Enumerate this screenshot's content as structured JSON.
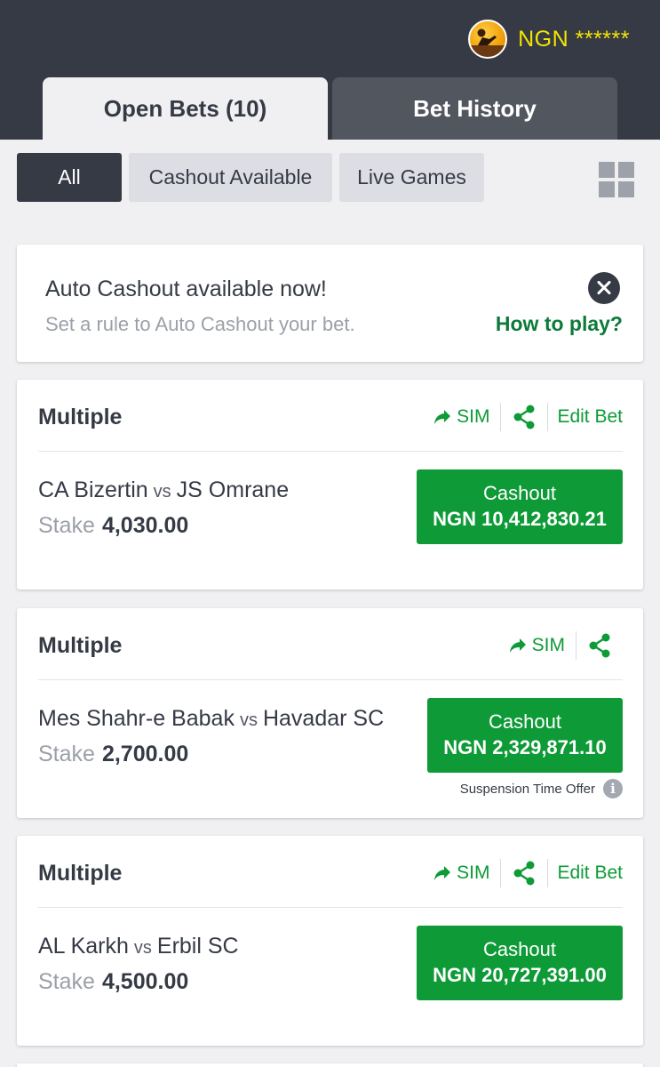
{
  "header": {
    "currency": "NGN",
    "balance_masked": "******",
    "balance_display": "NGN ******"
  },
  "tabs": [
    {
      "label": "Open Bets (10)",
      "active": true
    },
    {
      "label": "Bet History",
      "active": false
    }
  ],
  "filters": [
    {
      "label": "All",
      "selected": true
    },
    {
      "label": "Cashout Available",
      "selected": false
    },
    {
      "label": "Live Games",
      "selected": false
    }
  ],
  "promo": {
    "title": "Auto Cashout available now!",
    "subtitle": "Set a rule to Auto Cashout your bet.",
    "link": "How to play?"
  },
  "bets": [
    {
      "type": "Multiple",
      "sim_label": "SIM",
      "edit_label": "Edit Bet",
      "home": "CA Bizertin",
      "vs": "vs",
      "away": "JS Omrane",
      "stake_label": "Stake",
      "stake": "4,030.00",
      "cashout_label": "Cashout",
      "cashout_amount": "NGN 10,412,830.21"
    },
    {
      "type": "Multiple",
      "sim_label": "SIM",
      "home": "Mes Shahr-e Babak",
      "vs": "vs",
      "away": "Havadar SC",
      "stake_label": "Stake",
      "stake": "2,700.00",
      "cashout_label": "Cashout",
      "cashout_amount": "NGN 2,329,871.10",
      "note": "Suspension Time Offer"
    },
    {
      "type": "Multiple",
      "sim_label": "SIM",
      "edit_label": "Edit Bet",
      "home": "AL Karkh",
      "vs": "vs",
      "away": "Erbil SC",
      "stake_label": "Stake",
      "stake": "4,500.00",
      "cashout_label": "Cashout",
      "cashout_amount": "NGN 20,727,391.00"
    }
  ],
  "colors": {
    "header_bg": "#353a45",
    "balance_yellow": "#f5e400",
    "accent_green": "#0e9a37",
    "link_green": "#0d7a3a",
    "page_bg": "#f0f0f2"
  },
  "icons": {
    "avatar": "user-avatar",
    "promo_close": "close-icon",
    "sim": "forward-arrow-icon",
    "share": "share-icon",
    "grid": "grid-view-icon",
    "info": "info-icon"
  }
}
